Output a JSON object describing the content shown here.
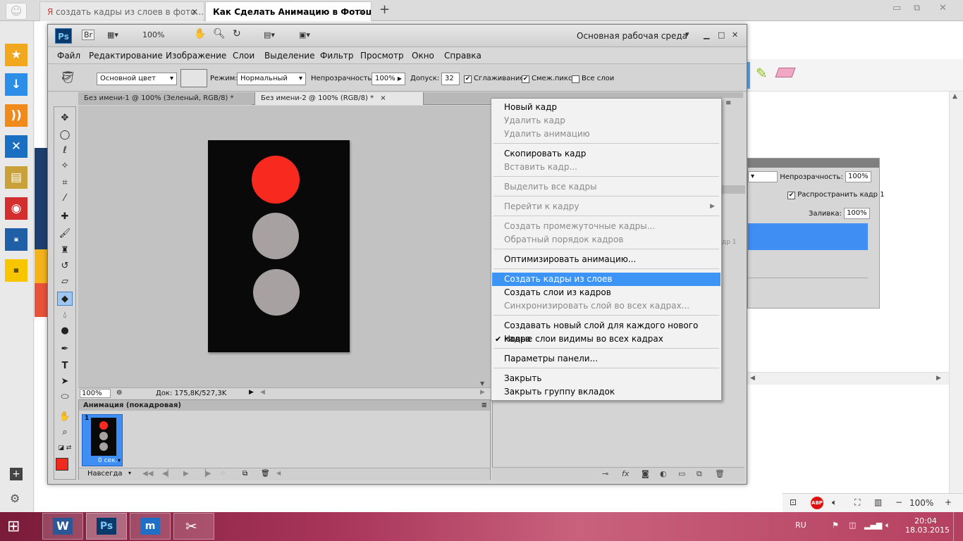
{
  "browser": {
    "tabs": [
      {
        "label": "создать кадры из слоев в фото..."
      },
      {
        "label": "Как Сделать Анимацию в Фотош..."
      }
    ],
    "new_tab": "+"
  },
  "photoshop": {
    "logo": "Ps",
    "bridge": "Br",
    "zoom": "100%",
    "workspace": "Основная рабочая среда",
    "menu": [
      "Файл",
      "Редактирование",
      "Изображение",
      "Слои",
      "Выделение",
      "Фильтр",
      "Просмотр",
      "Окно",
      "Справка"
    ],
    "options": {
      "source": "Основной цвет",
      "mode_label": "Режим:",
      "mode": "Нормальный",
      "opacity_label": "Непрозрачность:",
      "opacity": "100%",
      "tolerance_label": "Допуск:",
      "tolerance": "32",
      "antialias": "Сглаживание",
      "contiguous": "Смеж.пикс",
      "all_layers": "Все слои"
    },
    "doc_tabs": [
      {
        "label": "Без имени-1 @ 100% (Зеленый, RGB/8) *",
        "close": "×"
      },
      {
        "label": "Без имени-2 @ 100% (RGB/8) *",
        "close": "×"
      }
    ],
    "status": {
      "zoom": "100%",
      "doc": "Док: 175,8K/527,3K"
    },
    "animation": {
      "title": "Анимация (покадровая)",
      "frame_number": "1",
      "frame_delay": "0 сек.",
      "loop": "Навсегда"
    },
    "layers_fragment": {
      "opacity_label": "Непрозрачность:",
      "opacity": "100%",
      "propagate": "Распространить кадр 1",
      "fill_label": "Заливка:",
      "fill": "100%",
      "side_label": "др 1"
    },
    "colors": {
      "foreground": "#f0281e",
      "background": "#ffffff",
      "light_red": "#f82a1f",
      "light_gray": "#a7a1a1"
    }
  },
  "context_menu": {
    "items": [
      {
        "label": "Новый кадр",
        "state": "enabled"
      },
      {
        "label": "Удалить кадр",
        "state": "disabled"
      },
      {
        "label": "Удалить анимацию",
        "state": "disabled"
      },
      {
        "label": "Скопировать кадр",
        "state": "enabled"
      },
      {
        "label": "Вставить кадр...",
        "state": "disabled"
      },
      {
        "label": "Выделить все кадры",
        "state": "disabled"
      },
      {
        "label": "Перейти к кадру",
        "state": "disabled"
      },
      {
        "label": "Создать промежуточные кадры...",
        "state": "disabled"
      },
      {
        "label": "Обратный порядок кадров",
        "state": "disabled"
      },
      {
        "label": "Оптимизировать анимацию...",
        "state": "enabled"
      },
      {
        "label": "Создать кадры из слоев",
        "state": "highlighted"
      },
      {
        "label": "Создать слои из кадров",
        "state": "enabled"
      },
      {
        "label": "Синхронизировать слой во всех кадрах...",
        "state": "disabled"
      },
      {
        "label": "Создавать новый слой для каждого нового кадра",
        "state": "enabled"
      },
      {
        "label": "Новые слои видимы во всех кадрах",
        "state": "checked"
      },
      {
        "label": "Параметры панели...",
        "state": "enabled"
      },
      {
        "label": "Закрыть",
        "state": "enabled"
      },
      {
        "label": "Закрыть группу вкладок",
        "state": "enabled"
      }
    ]
  },
  "taskbar": {
    "language": "RU",
    "time": "20:04",
    "date": "18.03.2015",
    "browser_zoom": "100%"
  }
}
